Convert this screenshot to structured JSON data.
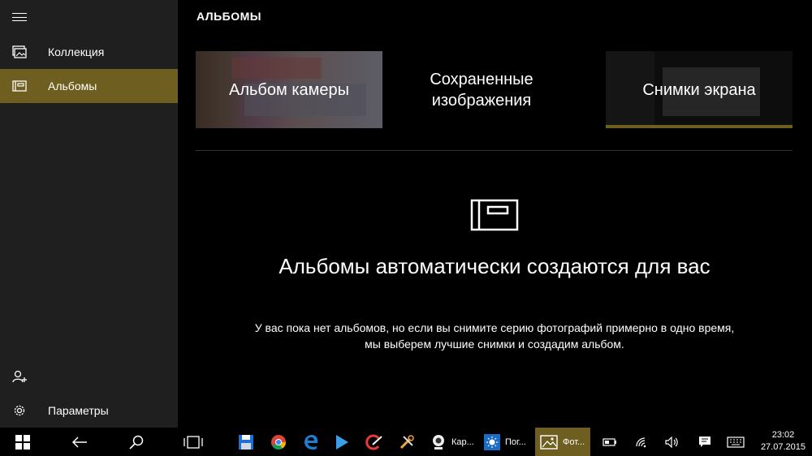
{
  "sidebar": {
    "items": [
      {
        "label": "Коллекция",
        "icon": "collection-icon"
      },
      {
        "label": "Альбомы",
        "icon": "album-icon"
      }
    ],
    "bottom_items": [
      {
        "label": "",
        "icon": "add-person-icon"
      },
      {
        "label": "Параметры",
        "icon": "gear-icon"
      }
    ],
    "accent_color": "#6e5e1f"
  },
  "header": {
    "title": "АЛЬБОМЫ"
  },
  "albums": [
    {
      "title": "Альбом камеры"
    },
    {
      "title": "Сохраненные изображения"
    },
    {
      "title": "Снимки экрана"
    }
  ],
  "empty_state": {
    "title": "Альбомы автоматически создаются для вас",
    "subtitle": "У вас пока нет альбомов, но если вы снимите серию фотографий примерно в одно время, мы выберем лучшие снимки и создадим альбом."
  },
  "taskbar": {
    "apps": [
      {
        "label": "Кар..."
      },
      {
        "label": "Пог..."
      },
      {
        "label": "Фот..."
      }
    ],
    "time": "23:02",
    "date": "27.07.2015"
  }
}
